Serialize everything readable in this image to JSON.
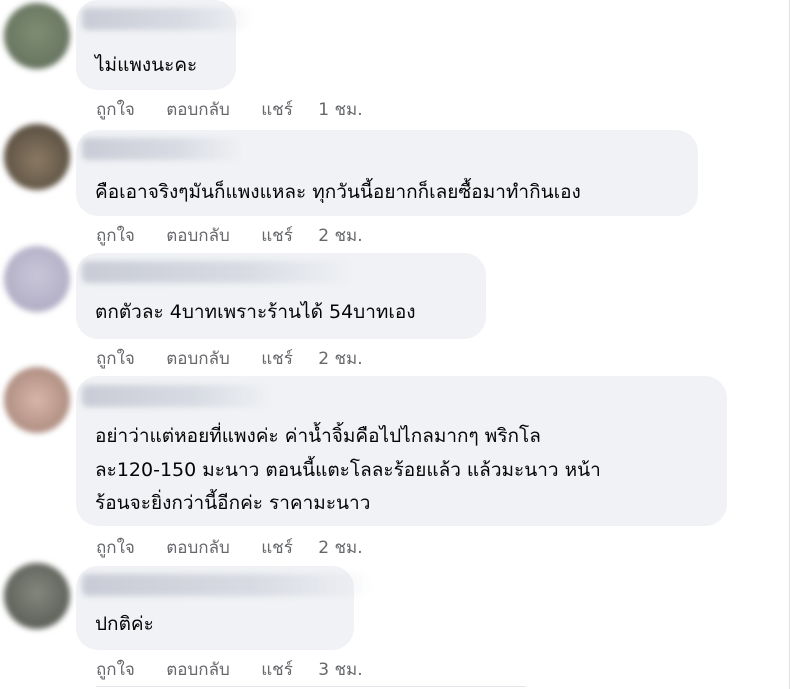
{
  "comments": [
    {
      "text": "ไม่แพงนะคะ",
      "time": "1 ชม."
    },
    {
      "text": "คือเอาจริงๆมันก็แพงแหละ ทุกวันนี้อยากก็เลยซื้อมาทำกินเอง",
      "time": "2 ชม."
    },
    {
      "text": "ตกตัวละ 4บาทเพราะร้านได้ 54บาทเอง",
      "time": "2 ชม."
    },
    {
      "lines": [
        "อย่าว่าแต่หอยที่แพงค่ะ ค่าน้ำจิ้มคือไปไกลมากๆ พริกโล",
        "ละ120-150 มะนาว ตอนนี้แตะโลละร้อยแล้ว แล้วมะนาว หน้า",
        "ร้อนจะยิ่งกว่านี้อีกค่ะ ราคามะนาว"
      ],
      "time": "2 ชม."
    },
    {
      "text": "ปกติค่ะ",
      "time": "3 ชม."
    }
  ],
  "actions": {
    "like": "ถูกใจ",
    "reply": "ตอบกลับ",
    "share": "แชร์"
  },
  "colors": {
    "bubble": "#f0f2f5",
    "meta": "#65676b",
    "text": "#050505"
  }
}
